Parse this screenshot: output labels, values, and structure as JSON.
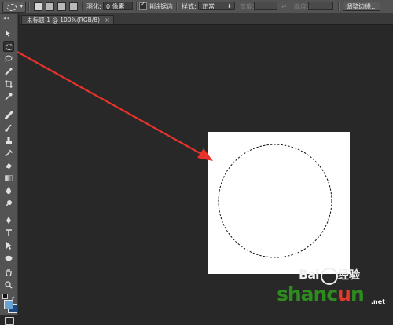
{
  "options_bar": {
    "feather_label": "羽化:",
    "feather_value": "0 像素",
    "antialias_label": "消除锯齿",
    "antialias_checked": true,
    "style_label": "样式:",
    "style_value": "正常",
    "width_label": "宽度:",
    "height_label": "高度:",
    "refine_edge_label": "调整边缘..."
  },
  "document_tab": {
    "title": "未标题-1 @ 100%(RGB/8)",
    "close": "×"
  },
  "toolbar": {
    "active_tool": "elliptical-marquee",
    "tools": [
      "move-icon",
      "elliptical-marquee-icon",
      "lasso-icon",
      "quick-selection-icon",
      "crop-icon",
      "eyedropper-icon",
      "spot-healing-icon",
      "brush-icon",
      "clone-stamp-icon",
      "history-brush-icon",
      "eraser-icon",
      "gradient-icon",
      "blur-icon",
      "dodge-icon",
      "pen-icon",
      "type-icon",
      "path-selection-icon",
      "ellipse-shape-icon",
      "hand-icon",
      "zoom-icon"
    ],
    "foreground_color": "#6aa2d2",
    "background_color": "#1c4b82"
  },
  "canvas": {
    "background": "#ffffff",
    "selection": "elliptical"
  },
  "annotation": {
    "arrow_color": "#e8322c"
  },
  "watermark": {
    "baidu": "Bai",
    "du": "du",
    "jingyan": "经验",
    "shancun_prefix": "shanc",
    "shancun_u": "u",
    "shancun_suffix": "n",
    "net": ".net"
  }
}
